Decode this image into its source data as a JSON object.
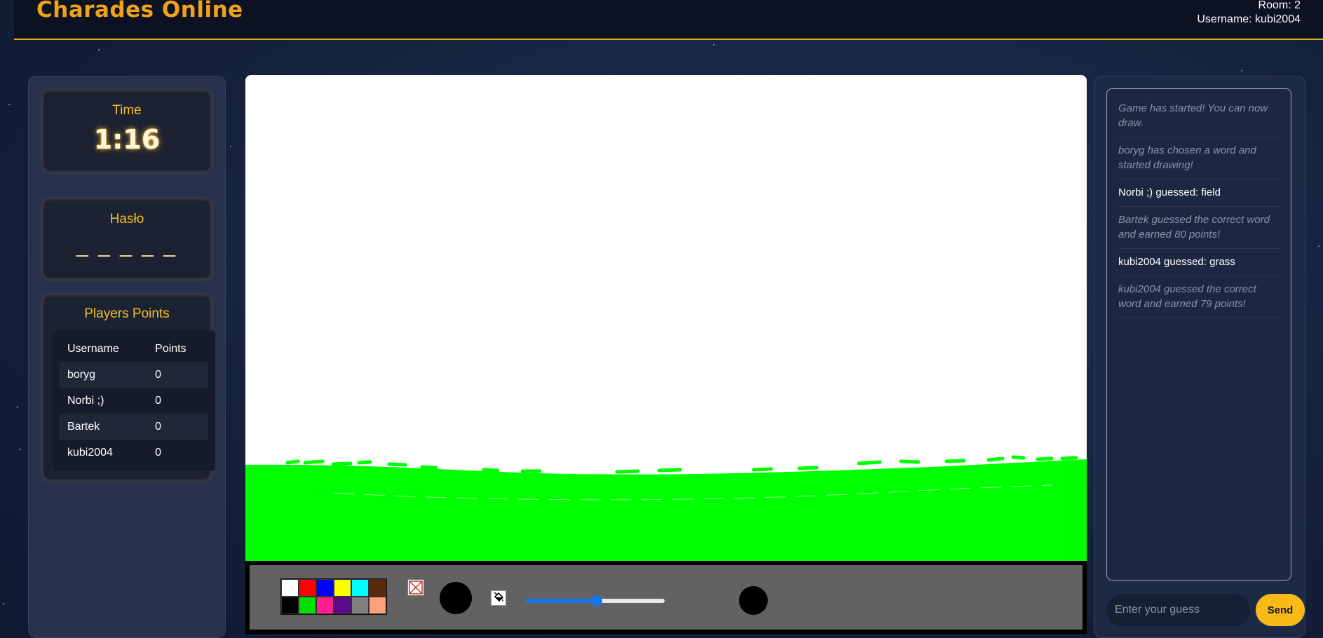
{
  "header": {
    "logo": "Charades Online",
    "room": "Room: 2",
    "username": "Username: kubi2004"
  },
  "timer": {
    "title": "Time",
    "value": "1:16"
  },
  "word": {
    "title": "Hasło",
    "value": "_ _ _ _ _"
  },
  "players": {
    "title": "Players Points",
    "headers": [
      "Username",
      "Points"
    ],
    "rows": [
      {
        "name": "boryg",
        "points": "0"
      },
      {
        "name": "Norbi ;)",
        "points": "0"
      },
      {
        "name": "Bartek",
        "points": "0"
      },
      {
        "name": "kubi2004",
        "points": "0"
      }
    ]
  },
  "toolbar": {
    "palette": [
      "#ffffff",
      "#ff0000",
      "#0000ff",
      "#ffff00",
      "#00ffff",
      "#5a2a0a",
      "#000000",
      "#00e000",
      "#ff1e90",
      "#5a0a8a",
      "#808080",
      "#ffa07a"
    ],
    "eraser_icon": "eraser-icon",
    "fill_icon": "paint-bucket-icon",
    "brush_size_fraction": 0.51,
    "current_color": "#000000",
    "grass_color": "#00ff00"
  },
  "chat": {
    "messages": [
      {
        "text": "Game has started! You can now draw.",
        "type": "sys"
      },
      {
        "text": "boryg has chosen a word and started drawing!",
        "type": "sys"
      },
      {
        "text": "Norbi ;) guessed: field",
        "type": "guess"
      },
      {
        "text": "Bartek guessed the correct word and earned 80 points!",
        "type": "sys"
      },
      {
        "text": "kubi2004 guessed: grass",
        "type": "guess"
      },
      {
        "text": "kubi2004 guessed the correct word and earned 79 points!",
        "type": "sys"
      }
    ],
    "input_placeholder": "Enter your guess",
    "send_label": "Send"
  }
}
